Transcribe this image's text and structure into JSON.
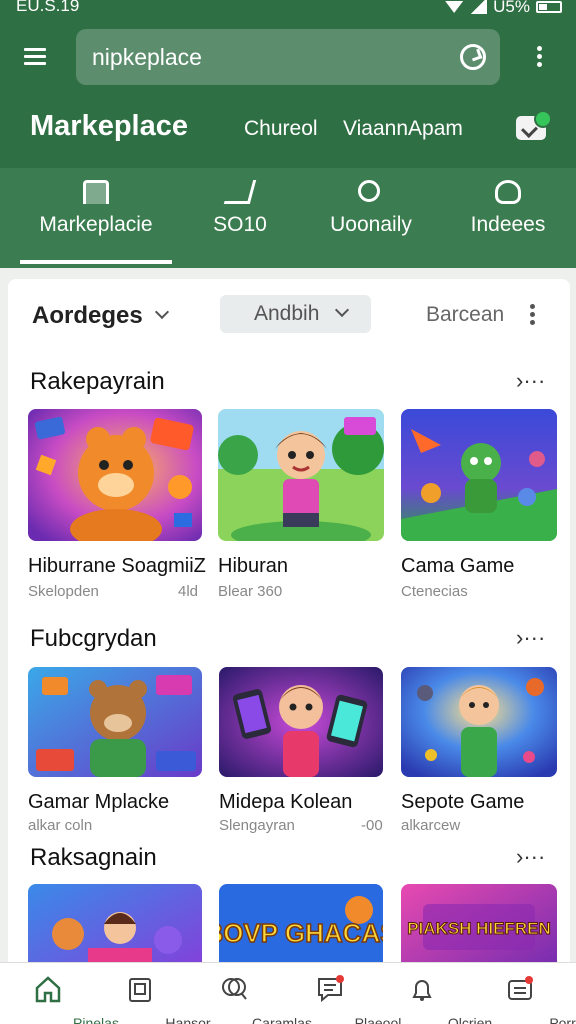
{
  "status_bar": {
    "time": "EU.S.19",
    "battery": "U5%"
  },
  "header": {
    "search_value": "nipkeplace",
    "title": "Markeplace",
    "links": [
      "Chureol",
      "ViaannApam"
    ]
  },
  "tabs": [
    {
      "label": "Markeplacie",
      "icon": "store-icon",
      "active": true
    },
    {
      "label": "SO10",
      "icon": "cart-icon",
      "active": false
    },
    {
      "label": "Uoonaily",
      "icon": "search-icon",
      "active": false
    },
    {
      "label": "Indeees",
      "icon": "user-icon",
      "active": false
    }
  ],
  "filters": {
    "sort_label": "Aordeges",
    "dropdown_value": "Andbih",
    "secondary_label": "Barcean"
  },
  "sections": [
    {
      "title": "Rakepayrain",
      "items": [
        {
          "name": "Hiburrane SoagmiiZ",
          "sub": "Skelopden",
          "meta": "4ld"
        },
        {
          "name": "Hiburan",
          "sub": "Blear 360",
          "meta": ""
        },
        {
          "name": "Cama Game",
          "sub": "Ctenecias",
          "meta": ""
        }
      ]
    },
    {
      "title": "Fubcgrydan",
      "items": [
        {
          "name": "Gamar Mplacke",
          "sub": "alkar coln",
          "meta": ""
        },
        {
          "name": "Midepa Kolean",
          "sub": "Slengayran",
          "meta": "-00"
        },
        {
          "name": "Sepote Game",
          "sub": "alkarcew",
          "meta": ""
        }
      ]
    },
    {
      "title": "Raksagnain",
      "items": [
        {
          "name": ""
        },
        {
          "name": "BOVP GHACAS",
          "banner": "BOVP GHACAS"
        },
        {
          "name": "",
          "banner": "PIAKSH HIEFREN"
        }
      ]
    }
  ],
  "bottom_nav": [
    {
      "label": "Pinelas",
      "icon": "home-icon",
      "active": true
    },
    {
      "label": "Hansor",
      "icon": "clipboard-icon",
      "active": false
    },
    {
      "label": "Caramlas",
      "icon": "search-icon",
      "active": false
    },
    {
      "label": "Plaeool",
      "icon": "chat-icon",
      "active": false
    },
    {
      "label": "Olcrien",
      "icon": "bell-icon",
      "active": false
    },
    {
      "label": "Porrel",
      "icon": "inbox-icon",
      "active": false
    }
  ],
  "colors": {
    "primary": "#2f6f44",
    "tab_bar": "#3b7d50",
    "accent": "#35c55a"
  }
}
